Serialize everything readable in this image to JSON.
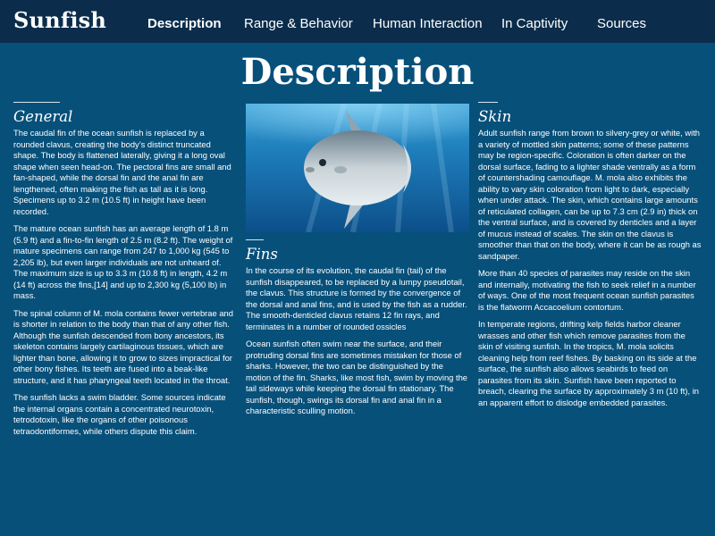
{
  "site": {
    "brand": "Sunfish"
  },
  "nav": [
    {
      "label": "Description",
      "active": true
    },
    {
      "label": "Range & Behavior",
      "active": false
    },
    {
      "label": "Human Interaction",
      "active": false
    },
    {
      "label": "In Captivity",
      "active": false
    },
    {
      "label": "Sources",
      "active": false
    }
  ],
  "page": {
    "title": "Description"
  },
  "sections": {
    "general": {
      "heading": "General",
      "paragraphs": [
        "The caudal fin of the ocean sunfish is replaced by a rounded clavus, creating the body’s distinct truncated shape. The body is flattened laterally, giving it a long oval shape when seen head-on. The pectoral fins are small and fan-shaped, while the dorsal fin and the anal fin are lengthened, often making the fish as tall as it is long. Specimens up to 3.2 m (10.5 ft) in height have been recorded.",
        "The mature ocean sunfish has an average length of 1.8 m (5.9 ft) and a fin-to-fin length of 2.5 m (8.2 ft). The weight of mature specimens can range from 247 to 1,000 kg (545 to 2,205 lb), but even larger individuals are not unheard of. The maximum size is up to 3.3 m (10.8 ft) in length, 4.2 m (14 ft) across the fins,[14] and up to 2,300 kg (5,100 lb) in mass.",
        "The spinal column of M. mola contains fewer vertebrae and is shorter in relation to the body than that of any other fish. Although the sunfish descended from bony ancestors, its skeleton contains largely cartilaginous tissues, which are lighter than bone, allowing it to grow to sizes impractical for other bony fishes. Its teeth are fused into a beak-like structure, and it has pharyngeal teeth located in the throat.",
        "The sunfish lacks a swim bladder. Some sources indicate the internal organs contain a concentrated neurotoxin, tetrodotoxin, like the organs of other poisonous tetraodontiformes, while others dispute this claim."
      ]
    },
    "fins": {
      "heading": "Fins",
      "paragraphs": [
        "In the course of its evolution, the caudal fin (tail) of the sunfish disappeared, to be replaced by a lumpy pseudotail, the clavus. This structure is formed by the convergence of the dorsal and anal fins, and is used by the fish as a rudder. The smooth-denticled clavus retains 12 fin rays, and terminates in a number of rounded ossicles",
        "Ocean sunfish often swim near the surface, and their protruding dorsal fins are sometimes mistaken for those of sharks. However, the two can be distinguished by the motion of the fin. Sharks, like most fish, swim by moving the tail sideways while keeping the dorsal fin stationary. The sunfish, though, swings its dorsal fin and anal fin in a characteristic sculling motion."
      ]
    },
    "skin": {
      "heading": "Skin",
      "paragraphs": [
        "Adult sunfish range from brown to silvery-grey or white, with a variety of mottled skin patterns; some of these patterns may be region-specific. Coloration is often darker on the dorsal surface, fading to a lighter shade ventrally as a form of countershading camouflage. M. mola also exhibits the ability to vary skin coloration from light to dark, especially when under attack. The skin, which contains large amounts of reticulated collagen, can be up to 7.3 cm (2.9 in) thick on the ventral surface, and is covered by denticles and a layer of mucus instead of scales. The skin on the clavus is smoother than that on the body, where it can be as rough as sandpaper.",
        "More than 40 species of parasites may reside on the skin and internally, motivating the fish to seek relief in a number of ways. One of the most frequent ocean sunfish parasites is the flatworm Accacoelium contortum.",
        "In temperate regions, drifting kelp fields harbor cleaner wrasses and other fish which remove parasites from the skin of visiting sunfish. In the tropics, M. mola solicits cleaning help from reef fishes. By basking on its side at the surface, the sunfish also allows seabirds to feed on parasites from its skin. Sunfish have been reported to breach, clearing the surface by approximately 3 m (10 ft), in an apparent effort to dislodge embedded parasites."
      ]
    }
  },
  "colors": {
    "page_background": "#07507a",
    "header_background": "#0b2d4b",
    "text": "#ffffff"
  }
}
